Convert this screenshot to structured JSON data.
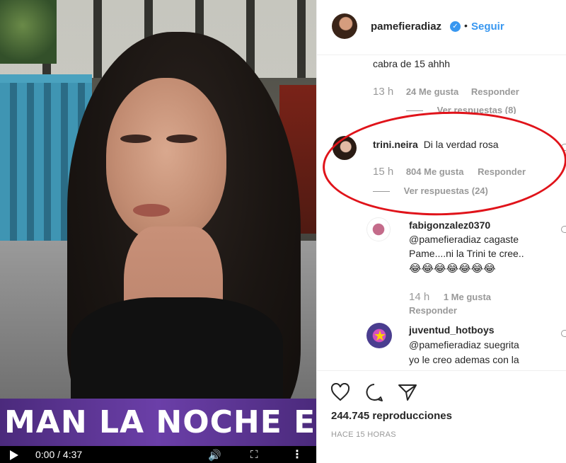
{
  "video": {
    "banner_text": "MAN LA NOCHE ES NU",
    "time": "0:00 / 4:37",
    "icons": [
      "play-icon",
      "volume-icon",
      "fullscreen-icon",
      "more-icon"
    ]
  },
  "header": {
    "username": "pamefieradiaz",
    "separator": "•",
    "follow_label": "Seguir"
  },
  "comments": [
    {
      "text": "cabra de 15 ahhh",
      "time": "13 h",
      "likes": "24 Me gusta",
      "reply": "Responder",
      "view_replies": "Ver respuestas (8)"
    },
    {
      "user": "trini.neira",
      "text": "Di la verdad rosa",
      "time": "15 h",
      "likes": "804 Me gusta",
      "reply": "Responder",
      "view_replies": "Ver respuestas (24)"
    },
    {
      "user": "fabigonzalez0370",
      "text_line1": "@pamefieradiaz cagaste",
      "text_line2": "Pame....ni la Trini te cree..",
      "emoji": "😂😂😂😂😂😂😂",
      "time": "14 h",
      "likes": "1 Me gusta",
      "reply": "Responder"
    },
    {
      "user": "juventud_hotboys",
      "text_line1": "@pamefieradiaz suegrita",
      "text_line2": "yo le creo ademas con la"
    }
  ],
  "footer": {
    "views": "244.745 reproducciones",
    "posted": "HACE 15 HORAS"
  },
  "colors": {
    "accent": "#3897f0",
    "highlight": "#e0131a",
    "muted": "#999999",
    "banner": "#6b3fa8"
  }
}
